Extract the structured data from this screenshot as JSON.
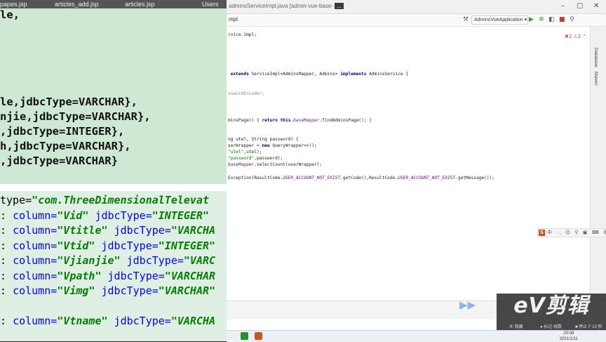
{
  "ide": {
    "title_path": "adminsServiceImpl.java [admin-vue-base-",
    "title_highlight": "...",
    "win_min": "–",
    "win_max": "▢",
    "win_close": "✕",
    "crumb": "mpl",
    "run_config": "AdminsVueApplication ▾",
    "right_tabs": [
      "Database",
      "Maven"
    ],
    "code_lines": [
      {
        "segments": [
          {
            "t": "rvice.impl;",
            "c": ""
          }
        ]
      },
      {
        "segments": [
          {
            "t": " extends ",
            "c": "kw"
          },
          {
            "t": "ServiceImpl<AdminsMapper, Admins> ",
            "c": ""
          },
          {
            "t": "implements ",
            "c": "kw"
          },
          {
            "t": "AdminsService {",
            "c": ""
          }
        ]
      },
      {
        "segments": [
          {
            "t": "sswordEncoder;",
            "c": "muted"
          }
        ]
      },
      {
        "segments": [
          {
            "t": "minsPage() { ",
            "c": ""
          },
          {
            "t": "return this",
            "c": "kw"
          },
          {
            "t": ".",
            "c": ""
          },
          {
            "t": "baseMapper",
            "c": "fld"
          },
          {
            "t": ".findAdminsPage(); }",
            "c": ""
          }
        ]
      },
      {
        "segments": [
          {
            "t": "ng utel, String password) {",
            "c": ""
          }
        ]
      },
      {
        "segments": [
          {
            "t": "serWrapper = ",
            "c": ""
          },
          {
            "t": "new ",
            "c": "kw"
          },
          {
            "t": "QueryWrapper<>();",
            "c": ""
          }
        ]
      },
      {
        "segments": [
          {
            "t": "\"utel\"",
            "c": "str"
          },
          {
            "t": ",utel);",
            "c": ""
          }
        ]
      },
      {
        "segments": [
          {
            "t": "\"password\"",
            "c": "str"
          },
          {
            "t": ",password);",
            "c": ""
          }
        ]
      },
      {
        "segments": [
          {
            "t": "baseMapper",
            "c": "fld"
          },
          {
            "t": ".selectCount(userWrapper);",
            "c": ""
          }
        ]
      },
      {
        "segments": [
          {
            "t": "Exception(ResultCode.",
            "c": ""
          },
          {
            "t": "USER_ACCOUNT_NOT_EXIST",
            "c": "fld"
          },
          {
            "t": ".getCode(),ResultCode.",
            "c": ""
          },
          {
            "t": "USER_ACCOUNT_NOT_EXIST",
            "c": "fld"
          },
          {
            "t": ".getMessage());",
            "c": ""
          }
        ]
      }
    ]
  },
  "ime": {
    "logo": "S",
    "items": "中 ·, ☺ ⚲ ▣ ⌨ ⚙"
  },
  "taskbar": {
    "time": "20:08",
    "date": "2021/1/11"
  },
  "ev": {
    "logo": "eV剪辑",
    "menu": [
      "▣ 隐藏",
      "● 标记 帧数",
      "■ 停止 F 10 秒"
    ]
  },
  "zoom": {
    "tabs": [
      "papes.jsp",
      "articles_add.jsp",
      "articles.jsp",
      "Users"
    ],
    "top_lines": [
      "le,",
      "",
      "",
      "",
      "",
      "",
      "le,jdbcType=VARCHAR},",
      "njie,jdbcType=VARCHAR},",
      ",jdbcType=INTEGER},",
      "h,jdbcType=VARCHAR},",
      ",jdbcType=VARCHAR}"
    ],
    "bottom_lines": [
      [
        {
          "t": "type=",
          "c": ""
        },
        {
          "t": "\"com.ThreeDimensionalTelevat",
          "c": "zs"
        }
      ],
      [
        {
          "t": ": ",
          "c": ""
        },
        {
          "t": "column=",
          "c": "za"
        },
        {
          "t": "\"Vid\"",
          "c": "zs"
        },
        {
          "t": " ",
          "c": ""
        },
        {
          "t": "jdbcType=",
          "c": "za"
        },
        {
          "t": "\"INTEGER\"",
          "c": "zs"
        }
      ],
      [
        {
          "t": ": ",
          "c": ""
        },
        {
          "t": "column=",
          "c": "za"
        },
        {
          "t": "\"Vtitle\"",
          "c": "zs"
        },
        {
          "t": " ",
          "c": ""
        },
        {
          "t": "jdbcType=",
          "c": "za"
        },
        {
          "t": "\"VARCHA",
          "c": "zs"
        }
      ],
      [
        {
          "t": ": ",
          "c": ""
        },
        {
          "t": "column=",
          "c": "za"
        },
        {
          "t": "\"Vtid\"",
          "c": "zs"
        },
        {
          "t": " ",
          "c": ""
        },
        {
          "t": "jdbcType=",
          "c": "za"
        },
        {
          "t": "\"INTEGER\"",
          "c": "zs"
        }
      ],
      [
        {
          "t": ": ",
          "c": ""
        },
        {
          "t": "column=",
          "c": "za"
        },
        {
          "t": "\"Vjianjie\"",
          "c": "zs"
        },
        {
          "t": " ",
          "c": ""
        },
        {
          "t": "jdbcType=",
          "c": "za"
        },
        {
          "t": "\"VARC",
          "c": "zs"
        }
      ],
      [
        {
          "t": ": ",
          "c": ""
        },
        {
          "t": "column=",
          "c": "za"
        },
        {
          "t": "\"Vpath\"",
          "c": "zs"
        },
        {
          "t": " ",
          "c": ""
        },
        {
          "t": "jdbcType=",
          "c": "za"
        },
        {
          "t": "\"VARCHAR",
          "c": "zs"
        }
      ],
      [
        {
          "t": ": ",
          "c": ""
        },
        {
          "t": "column=",
          "c": "za"
        },
        {
          "t": "\"Vimg\"",
          "c": "zs"
        },
        {
          "t": " ",
          "c": ""
        },
        {
          "t": "jdbcType=",
          "c": "za"
        },
        {
          "t": "\"VARCHAR\"",
          "c": "zs"
        }
      ],
      [
        {
          "t": "",
          "c": ""
        }
      ],
      [
        {
          "t": ": ",
          "c": ""
        },
        {
          "t": "column=",
          "c": "za"
        },
        {
          "t": "\"Vtname\"",
          "c": "zs"
        },
        {
          "t": " ",
          "c": ""
        },
        {
          "t": "jdbcType=",
          "c": "za"
        },
        {
          "t": "\"VARCHA",
          "c": "zs"
        }
      ]
    ]
  }
}
